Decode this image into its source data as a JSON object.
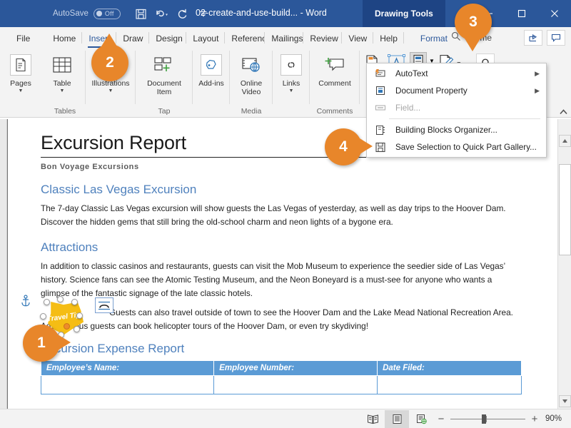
{
  "titlebar": {
    "autosave_label": "AutoSave",
    "autosave_state": "Off",
    "save_icon": "save-icon",
    "undo_icon": "undo-icon",
    "redo_icon": "redo-icon",
    "customize_icon": "customize-quick-access-icon",
    "document_title": "02-create-and-use-build... - Word",
    "contextual_tab": "Drawing Tools",
    "minimize": "minimize-icon",
    "maximize": "maximize-icon",
    "close": "close-icon",
    "accent_color": "#2b579a",
    "contextual_color": "#1e4484"
  },
  "tabs": [
    {
      "label": "File",
      "active": false
    },
    {
      "label": "Home",
      "active": false
    },
    {
      "label": "Insert",
      "active": true
    },
    {
      "label": "Draw",
      "active": false
    },
    {
      "label": "Design",
      "active": false
    },
    {
      "label": "Layout",
      "active": false
    },
    {
      "label": "References",
      "active": false
    },
    {
      "label": "Mailings",
      "active": false
    },
    {
      "label": "Review",
      "active": false
    },
    {
      "label": "View",
      "active": false
    },
    {
      "label": "Help",
      "active": false
    }
  ],
  "format_tab": "Format",
  "tellme": {
    "placeholder": "Tell me",
    "icon": "search-icon"
  },
  "right_icons": [
    {
      "name": "share-icon"
    },
    {
      "name": "comments-icon"
    }
  ],
  "ribbon": {
    "groups": [
      {
        "label": "",
        "buttons": [
          {
            "label": "Pages",
            "icon": "pages-icon",
            "caret": true
          }
        ]
      },
      {
        "label": "Tables",
        "buttons": [
          {
            "label": "Table",
            "icon": "table-icon",
            "caret": true
          }
        ]
      },
      {
        "label": "",
        "buttons": [
          {
            "label": "Illustrations",
            "icon": "illustrations-icon",
            "caret": true
          }
        ]
      },
      {
        "label": "Tap",
        "buttons": [
          {
            "label": "Document Item",
            "icon": "document-item-icon",
            "caret": false
          }
        ]
      },
      {
        "label": "",
        "buttons": [
          {
            "label": "Add-ins",
            "icon": "add-ins-icon",
            "caret": true
          }
        ]
      },
      {
        "label": "Media",
        "buttons": [
          {
            "label": "Online Video",
            "icon": "online-video-icon",
            "caret": false
          }
        ]
      },
      {
        "label": "",
        "buttons": [
          {
            "label": "Links",
            "icon": "links-icon",
            "caret": true
          }
        ]
      },
      {
        "label": "Comments",
        "buttons": [
          {
            "label": "Comment",
            "icon": "comment-icon",
            "caret": false
          }
        ]
      }
    ],
    "text_group": [
      {
        "name": "text-box-icon",
        "caret": false
      },
      {
        "name": "wordart-icon",
        "caret": false
      },
      {
        "name": "quick-parts-icon",
        "caret": true,
        "pressed": true
      },
      {
        "name": "signature-line-icon",
        "caret": true
      },
      {
        "name": "symbol-icon",
        "caret": false
      }
    ]
  },
  "menu": {
    "items": [
      {
        "label": "AutoText",
        "accel": "A",
        "icon": "autotext-icon",
        "submenu": true,
        "disabled": false
      },
      {
        "label": "Document Property",
        "accel": "D",
        "icon": "document-property-icon",
        "submenu": true,
        "disabled": false
      },
      {
        "label": "Field...",
        "accel": "F",
        "icon": "field-icon",
        "submenu": false,
        "disabled": true
      },
      {
        "label": "Building Blocks Organizer...",
        "accel": "B",
        "icon": "building-blocks-organizer-icon",
        "submenu": false,
        "disabled": false
      },
      {
        "label": "Save Selection to Quick Part Gallery...",
        "accel": "S",
        "icon": "save-selection-icon",
        "submenu": false,
        "disabled": false
      }
    ]
  },
  "document": {
    "title": "Excursion Report",
    "subtitle": "Bon Voyage Excursions",
    "heading1": "Classic Las Vegas Excursion",
    "para1": "The 7-day Classic Las Vegas excursion will show guests the Las Vegas of yesterday, as well as day trips to the Hoover Dam. Discover the hidden gems that still bring the old-school charm and neon lights of a bygone era.",
    "heading2": "Attractions",
    "para2": "In addition to classic casinos and restaurants, guests can visit the Mob Museum to experience the seedier side of Las Vegas’ history. Science fans can see the Atomic Testing Museum, and the Neon Boneyard is a must-see for anyone who wants a glimpse of the fantastic signage of the late classic hotels.",
    "para3": "Guests can also travel outside of town to see the Hoover Dam and the Lake Mead National Recreation Area. Adventurous guests can book helicopter tours of the Hoover Dam, or even try skydiving!",
    "tip_shape_text": "Travel Tip!",
    "heading3": "Excursion Expense Report",
    "table": {
      "headers": [
        "Employee’s Name:",
        "Employee Number:",
        "Date Filed:"
      ],
      "rows": [
        [
          "",
          "",
          ""
        ]
      ]
    }
  },
  "statusbar": {
    "views": [
      {
        "name": "read-mode-icon",
        "active": false
      },
      {
        "name": "print-layout-icon",
        "active": true
      },
      {
        "name": "web-layout-icon",
        "active": false
      }
    ],
    "zoom_out": "−",
    "zoom_in": "+",
    "zoom_level": "90%"
  },
  "markers": [
    {
      "number": "1",
      "direction": "right"
    },
    {
      "number": "2",
      "direction": "up"
    },
    {
      "number": "3",
      "direction": "down"
    },
    {
      "number": "4",
      "direction": "right"
    }
  ],
  "marker_color": "#e8862a"
}
